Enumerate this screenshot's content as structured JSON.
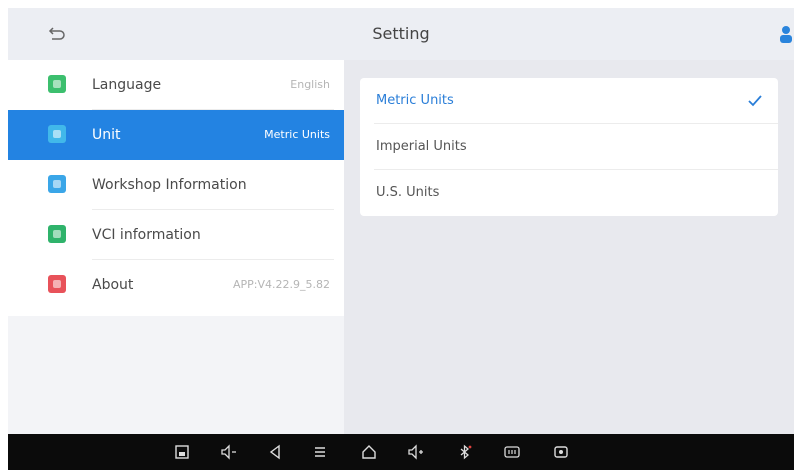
{
  "header": {
    "title": "Setting"
  },
  "sidebar": {
    "items": [
      {
        "label": "Language",
        "value": "English",
        "icon": "language-icon",
        "color": "#3cbf6e",
        "selected": false
      },
      {
        "label": "Unit",
        "value": "Metric Units",
        "icon": "unit-icon",
        "color": "#41b8ea",
        "selected": true
      },
      {
        "label": "Workshop Information",
        "value": "",
        "icon": "workshop-icon",
        "color": "#3aa6e8",
        "selected": false
      },
      {
        "label": "VCI information",
        "value": "",
        "icon": "vci-icon",
        "color": "#2fb36b",
        "selected": false
      },
      {
        "label": "About",
        "value": "APP:V4.22.9_5.82",
        "icon": "about-icon",
        "color": "#e8525a",
        "selected": false
      }
    ]
  },
  "units": {
    "options": [
      {
        "label": "Metric Units",
        "selected": true
      },
      {
        "label": "Imperial Units",
        "selected": false
      },
      {
        "label": "U.S. Units",
        "selected": false
      }
    ]
  },
  "colors": {
    "accent": "#2383e2",
    "navbar": "#0b0b0b",
    "panel_bg": "#e8e9ee"
  },
  "navbar": {
    "icons": [
      "screenshot-icon",
      "volume-down-icon",
      "back-icon",
      "menu-icon",
      "home-icon",
      "volume-up-icon",
      "bluetooth-icon",
      "vci-status-icon",
      "screen-record-icon"
    ]
  }
}
